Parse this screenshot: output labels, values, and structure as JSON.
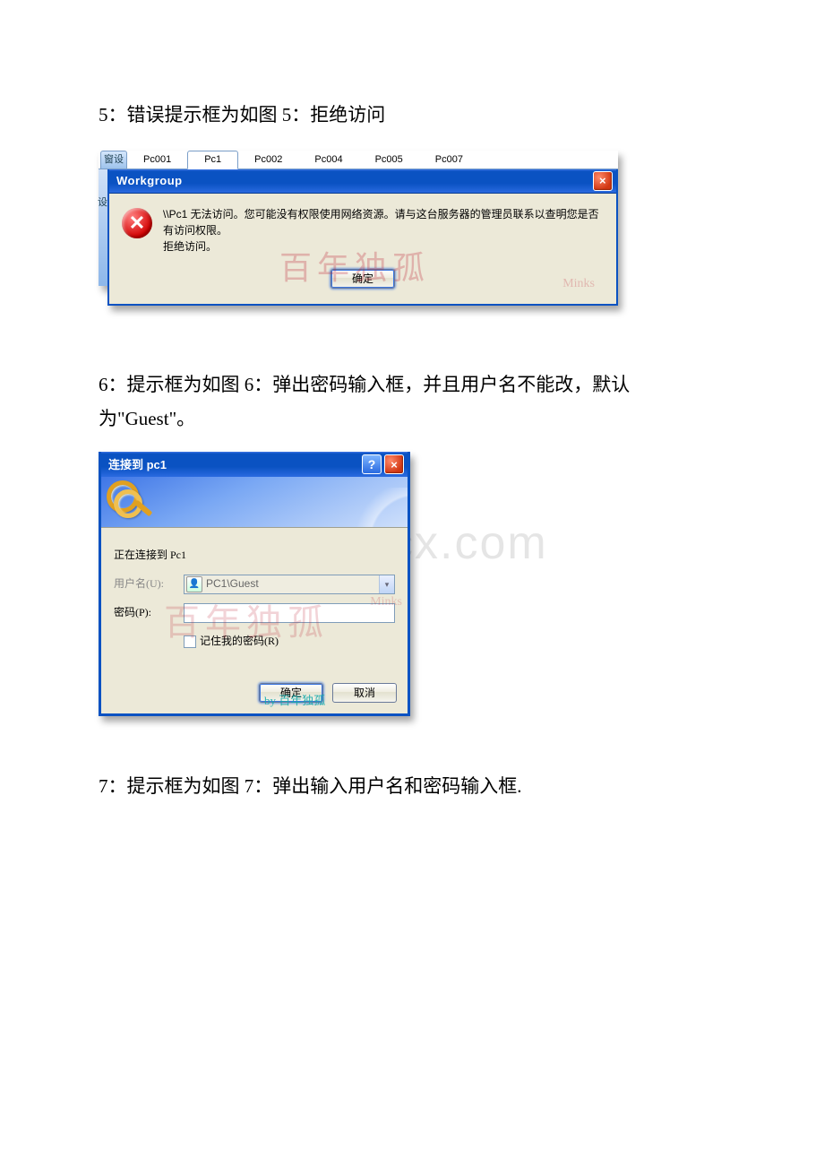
{
  "doc": {
    "para5": "5：错误提示框为如图 5：拒绝访问",
    "para6": "6：提示框为如图 6：弹出密码输入框，并且用户名不能改，默认为\"Guest\"。",
    "para7": "7：提示框为如图 7：弹出输入用户名和密码输入框.",
    "big_watermark": "www.bdocx.com"
  },
  "shot1": {
    "tab_left": "窗设",
    "left_strip": "设",
    "tabs": [
      "Pc001",
      "Pc1",
      "Pc002",
      "Pc004",
      "Pc005",
      "Pc007"
    ],
    "active_tab_index": 1,
    "dialog_title": "Workgroup",
    "close_label": "×",
    "message_line1": "\\\\Pc1 无法访问。您可能没有权限使用网络资源。请与这台服务器的管理员联系以查明您是否有访问权限。",
    "message_line2": "拒绝访问。",
    "ok_label": "确定",
    "watermark_text": "百年独孤",
    "watermark_name": "Minks"
  },
  "shot2": {
    "dialog_title": "连接到 pc1",
    "help_label": "?",
    "close_label": "×",
    "connecting_text": "正在连接到 Pc1",
    "username_label": "用户名(U):",
    "username_value": "PC1\\Guest",
    "password_label": "密码(P):",
    "password_value": "",
    "remember_label": "记住我的密码(R)",
    "ok_label": "确定",
    "cancel_label": "取消",
    "watermark_text": "百年独孤",
    "watermark_name": "Minks",
    "watermark_cyan": "by 百年独孤"
  }
}
